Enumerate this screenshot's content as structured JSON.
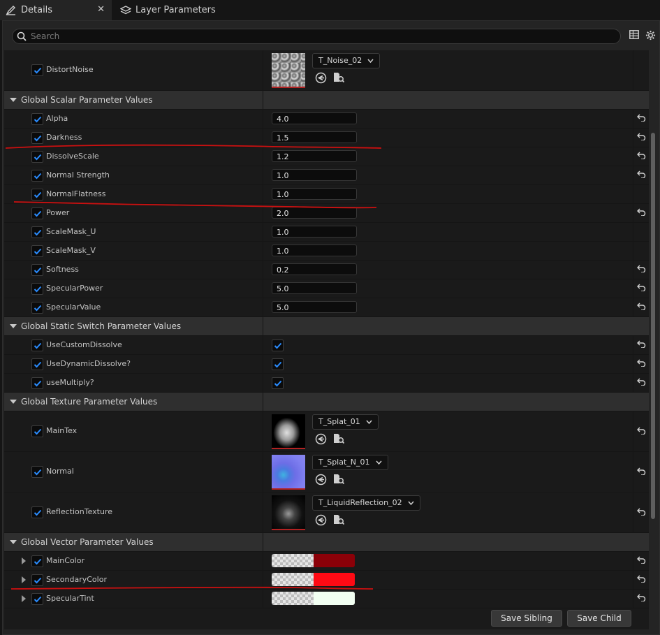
{
  "tabs": [
    {
      "label": "Details",
      "icon": "pencil-icon",
      "closable": true
    },
    {
      "label": "Layer Parameters",
      "icon": "layers-icon"
    }
  ],
  "search": {
    "placeholder": "Search"
  },
  "toolbar": {
    "icons": [
      "table-view-icon",
      "settings-gear-icon"
    ]
  },
  "top_row": {
    "name": "DistortNoise",
    "asset": "T_Noise_02"
  },
  "categories": {
    "scalar": "Global Scalar Parameter Values",
    "static_switch": "Global Static Switch Parameter Values",
    "texture": "Global Texture Parameter Values",
    "vector": "Global Vector Parameter Values"
  },
  "scalar_params": [
    {
      "name": "Alpha",
      "value": "4.0",
      "reset": true
    },
    {
      "name": "Darkness",
      "value": "1.5",
      "reset": true
    },
    {
      "name": "DissolveScale",
      "value": "1.2",
      "reset": true
    },
    {
      "name": "Normal Strength",
      "value": "1.0",
      "reset": true
    },
    {
      "name": "NormalFlatness",
      "value": "1.0",
      "reset": false
    },
    {
      "name": "Power",
      "value": "2.0",
      "reset": true
    },
    {
      "name": "ScaleMask_U",
      "value": "1.0",
      "reset": false
    },
    {
      "name": "ScaleMask_V",
      "value": "1.0",
      "reset": false
    },
    {
      "name": "Softness",
      "value": "0.2",
      "reset": true
    },
    {
      "name": "SpecularPower",
      "value": "5.0",
      "reset": true
    },
    {
      "name": "SpecularValue",
      "value": "5.0",
      "reset": true
    }
  ],
  "switch_params": [
    {
      "name": "UseCustomDissolve",
      "value": true
    },
    {
      "name": "UseDynamicDissolve?",
      "value": true
    },
    {
      "name": "useMultiply?",
      "value": true
    }
  ],
  "texture_params": [
    {
      "name": "MainTex",
      "asset": "T_Splat_01"
    },
    {
      "name": "Normal",
      "asset": "T_Splat_N_01"
    },
    {
      "name": "ReflectionTexture",
      "asset": "T_LiquidReflection_02"
    }
  ],
  "vector_params": [
    {
      "name": "MainColor",
      "color": "#8b0008"
    },
    {
      "name": "SecondaryColor",
      "color": "#ff0a14"
    },
    {
      "name": "SpecularTint",
      "color": "#f2fff2"
    }
  ],
  "footer": {
    "save_sibling": "Save Sibling",
    "save_child": "Save Child"
  },
  "colors": {
    "panel_bg": "#242424",
    "row_bg": "#1a1a1a",
    "category_bg": "#2f2f2f",
    "checkbox_check": "#2a8cff",
    "annotation_stroke": "#cc1010"
  }
}
